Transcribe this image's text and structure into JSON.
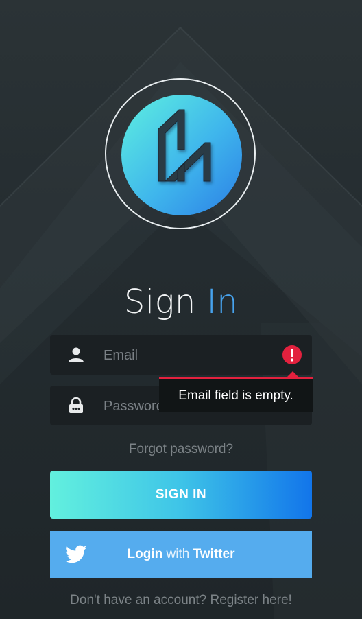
{
  "brand": {
    "logo_name": "logo-mark",
    "accent_colors": [
      "#5ef0e0",
      "#2b7fe6"
    ]
  },
  "heading": {
    "word1": "Sign",
    "word2": "In"
  },
  "email_field": {
    "placeholder": "Email",
    "value": "",
    "icon": "user-icon",
    "error_icon": "error-icon"
  },
  "password_field": {
    "placeholder": "Password",
    "value": "",
    "icon": "lock-icon"
  },
  "error_tooltip": {
    "message": "Email field is empty.",
    "color": "#e3213e"
  },
  "forgot_password": "Forgot password?",
  "signin_button": "SIGN IN",
  "twitter_button": {
    "part1": "Login",
    "part2": "with",
    "part3": "Twitter",
    "icon": "twitter-icon",
    "color": "#55acee"
  },
  "register_link": "Don't have an account? Register here!"
}
